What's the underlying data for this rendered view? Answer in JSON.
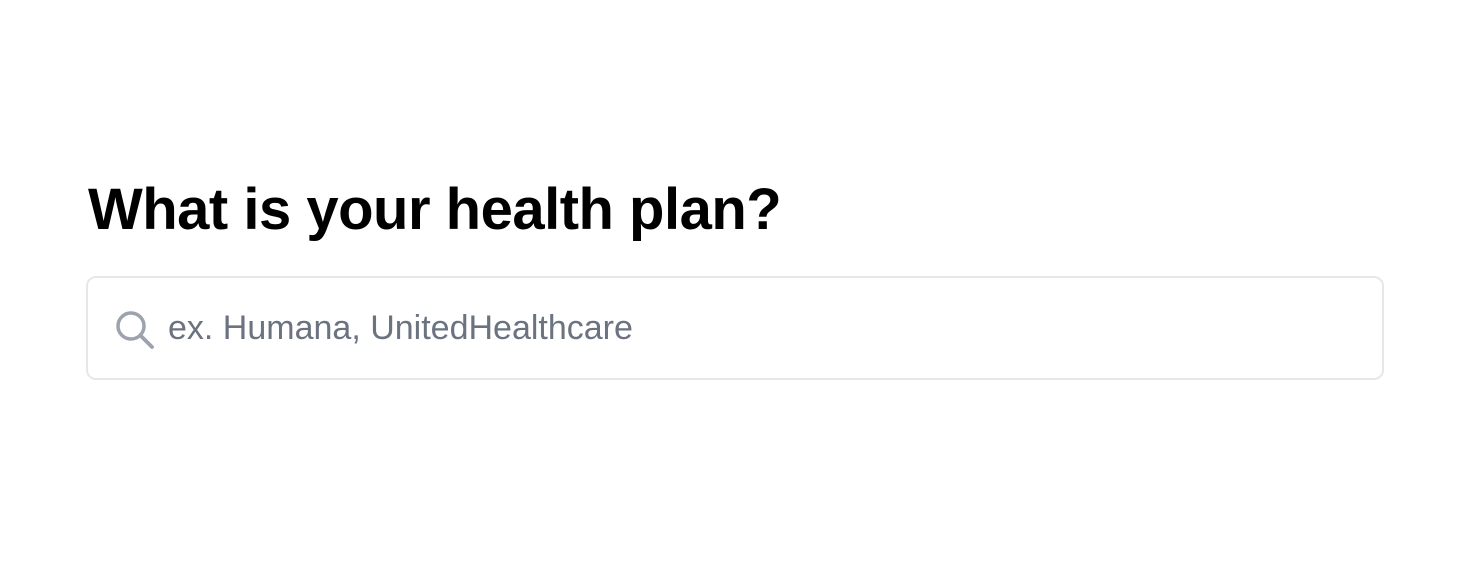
{
  "question": {
    "title": "What is your health plan?"
  },
  "search": {
    "value": "",
    "placeholder": "ex. Humana, UnitedHealthcare",
    "icon": "search-icon"
  },
  "colors": {
    "title_text": "#000000",
    "input_border": "#e5e7eb",
    "placeholder_text": "#6b7280",
    "icon_stroke": "#9ca3af",
    "background": "#ffffff"
  }
}
